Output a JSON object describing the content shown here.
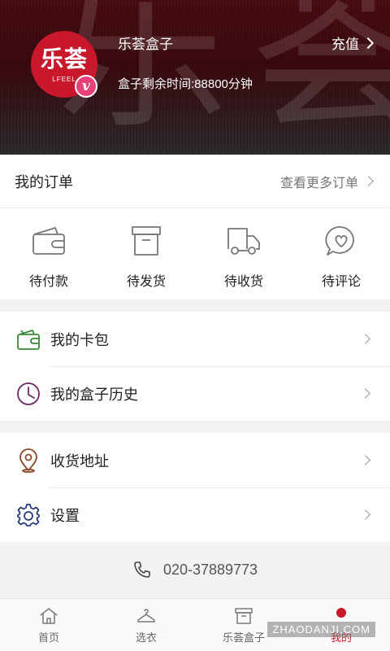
{
  "header": {
    "bg_text": "乐荟",
    "logo_text": "乐荟",
    "logo_sub": "LFEEL",
    "vip_badge": "v",
    "user_name": "乐荟盒子",
    "time_label": "盒子剩余时间:88800分钟",
    "recharge": "充值",
    "bg_color": "#3a0a0e",
    "logo_color": "#c9182b",
    "badge_color": "#e8417a"
  },
  "orders": {
    "title": "我的订单",
    "more": "查看更多订单",
    "items": [
      {
        "label": "待付款",
        "icon": "wallet-icon"
      },
      {
        "label": "待发货",
        "icon": "box-icon"
      },
      {
        "label": "待收货",
        "icon": "truck-icon"
      },
      {
        "label": "待评论",
        "icon": "heart-chat-icon"
      }
    ]
  },
  "menu": {
    "card_wallet": "我的卡包",
    "box_history": "我的盒子历史",
    "address": "收货地址",
    "settings": "设置"
  },
  "phone": "020-37889773",
  "tabbar": {
    "items": [
      {
        "label": "首页",
        "icon": "home-icon"
      },
      {
        "label": "选衣",
        "icon": "hanger-icon"
      },
      {
        "label": "乐荟盒子",
        "icon": "box-icon"
      },
      {
        "label": "我的",
        "icon": "user-icon",
        "active": true
      }
    ],
    "active_color": "#c9182b"
  },
  "watermark": "ZHAODANJI.COM"
}
